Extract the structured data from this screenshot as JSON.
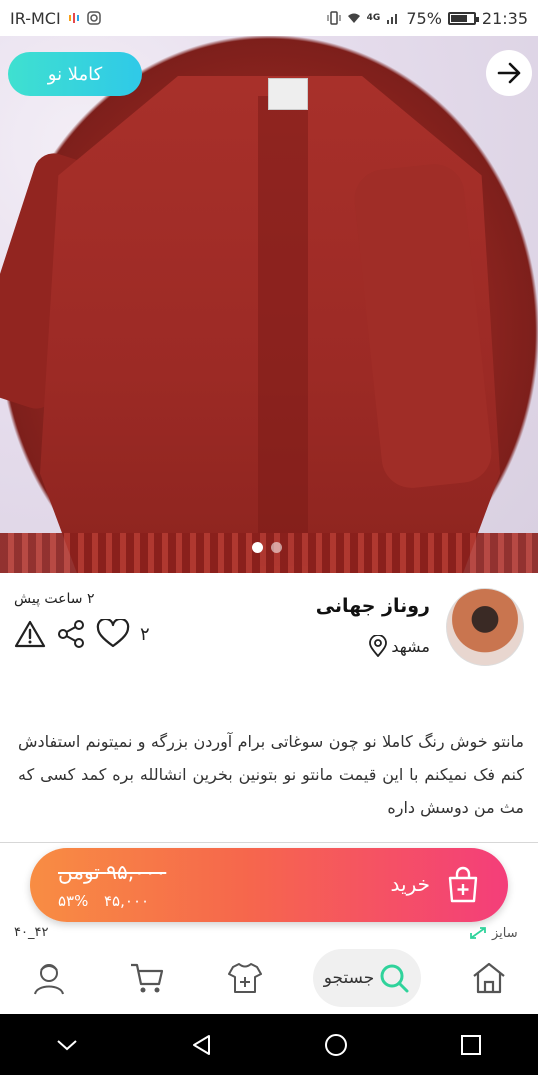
{
  "status_bar": {
    "carrier": "IR-MCI",
    "battery_text": "75%",
    "battery_level": 0.75,
    "time": "21:35",
    "network": "4G"
  },
  "product": {
    "badge": "کاملا نو",
    "image_index": 1,
    "image_count": 2
  },
  "seller": {
    "name": "روناز جهانی",
    "city": "مشهد",
    "time_ago": "۲ ساعت پیش",
    "likes": "۲"
  },
  "description": "مانتو خوش رنگ  کاملا نو چون سوغاتی برام آوردن بزرگه و نمیتونم استفادش کنم فک نمیکنم با این قیمت مانتو نو بتونین بخرین انشالله بره کمد کسی که مث من دوسش داره",
  "purchase": {
    "buy_label": "خرید",
    "old_price": "۹۵,۰۰۰ تومن",
    "new_price": "۴۵,۰۰۰",
    "discount": "۵۳%"
  },
  "meta": {
    "product_code": "۴۰_۴۲",
    "size_label": "سایز"
  },
  "bottom_nav": {
    "search_label": "جستجو"
  },
  "colors": {
    "badge_gradient_start": "#3fe0d0",
    "badge_gradient_end": "#2fc9e8",
    "buy_gradient_start": "#f88d43",
    "buy_gradient_end": "#f43e7a",
    "search_accent": "#2fd39b"
  },
  "icons": [
    "arrow-right-icon",
    "map-pin-icon",
    "heart-icon",
    "share-icon",
    "warning-icon",
    "shopping-bag-plus-icon",
    "home-icon",
    "search-icon",
    "add-shirt-icon",
    "cart-icon",
    "profile-icon"
  ]
}
